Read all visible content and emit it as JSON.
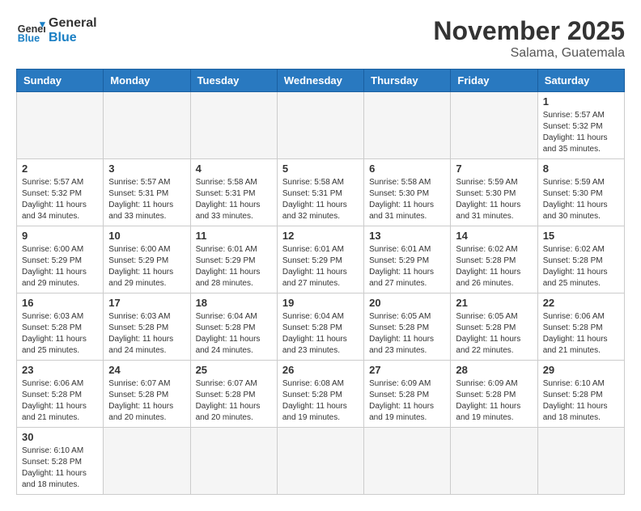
{
  "header": {
    "logo_general": "General",
    "logo_blue": "Blue",
    "month_title": "November 2025",
    "location": "Salama, Guatemala"
  },
  "weekdays": [
    "Sunday",
    "Monday",
    "Tuesday",
    "Wednesday",
    "Thursday",
    "Friday",
    "Saturday"
  ],
  "days": [
    {
      "date": "1",
      "empty": false,
      "colspan": false,
      "startCol": 6,
      "sunrise": "5:57 AM",
      "sunset": "5:32 PM",
      "daylight": "11 hours and 35 minutes."
    },
    {
      "date": "2",
      "sunrise": "5:57 AM",
      "sunset": "5:32 PM",
      "daylight": "11 hours and 34 minutes."
    },
    {
      "date": "3",
      "sunrise": "5:57 AM",
      "sunset": "5:31 PM",
      "daylight": "11 hours and 33 minutes."
    },
    {
      "date": "4",
      "sunrise": "5:58 AM",
      "sunset": "5:31 PM",
      "daylight": "11 hours and 33 minutes."
    },
    {
      "date": "5",
      "sunrise": "5:58 AM",
      "sunset": "5:31 PM",
      "daylight": "11 hours and 32 minutes."
    },
    {
      "date": "6",
      "sunrise": "5:58 AM",
      "sunset": "5:30 PM",
      "daylight": "11 hours and 31 minutes."
    },
    {
      "date": "7",
      "sunrise": "5:59 AM",
      "sunset": "5:30 PM",
      "daylight": "11 hours and 31 minutes."
    },
    {
      "date": "8",
      "sunrise": "5:59 AM",
      "sunset": "5:30 PM",
      "daylight": "11 hours and 30 minutes."
    },
    {
      "date": "9",
      "sunrise": "6:00 AM",
      "sunset": "5:29 PM",
      "daylight": "11 hours and 29 minutes."
    },
    {
      "date": "10",
      "sunrise": "6:00 AM",
      "sunset": "5:29 PM",
      "daylight": "11 hours and 29 minutes."
    },
    {
      "date": "11",
      "sunrise": "6:01 AM",
      "sunset": "5:29 PM",
      "daylight": "11 hours and 28 minutes."
    },
    {
      "date": "12",
      "sunrise": "6:01 AM",
      "sunset": "5:29 PM",
      "daylight": "11 hours and 27 minutes."
    },
    {
      "date": "13",
      "sunrise": "6:01 AM",
      "sunset": "5:29 PM",
      "daylight": "11 hours and 27 minutes."
    },
    {
      "date": "14",
      "sunrise": "6:02 AM",
      "sunset": "5:28 PM",
      "daylight": "11 hours and 26 minutes."
    },
    {
      "date": "15",
      "sunrise": "6:02 AM",
      "sunset": "5:28 PM",
      "daylight": "11 hours and 25 minutes."
    },
    {
      "date": "16",
      "sunrise": "6:03 AM",
      "sunset": "5:28 PM",
      "daylight": "11 hours and 25 minutes."
    },
    {
      "date": "17",
      "sunrise": "6:03 AM",
      "sunset": "5:28 PM",
      "daylight": "11 hours and 24 minutes."
    },
    {
      "date": "18",
      "sunrise": "6:04 AM",
      "sunset": "5:28 PM",
      "daylight": "11 hours and 24 minutes."
    },
    {
      "date": "19",
      "sunrise": "6:04 AM",
      "sunset": "5:28 PM",
      "daylight": "11 hours and 23 minutes."
    },
    {
      "date": "20",
      "sunrise": "6:05 AM",
      "sunset": "5:28 PM",
      "daylight": "11 hours and 23 minutes."
    },
    {
      "date": "21",
      "sunrise": "6:05 AM",
      "sunset": "5:28 PM",
      "daylight": "11 hours and 22 minutes."
    },
    {
      "date": "22",
      "sunrise": "6:06 AM",
      "sunset": "5:28 PM",
      "daylight": "11 hours and 21 minutes."
    },
    {
      "date": "23",
      "sunrise": "6:06 AM",
      "sunset": "5:28 PM",
      "daylight": "11 hours and 21 minutes."
    },
    {
      "date": "24",
      "sunrise": "6:07 AM",
      "sunset": "5:28 PM",
      "daylight": "11 hours and 20 minutes."
    },
    {
      "date": "25",
      "sunrise": "6:07 AM",
      "sunset": "5:28 PM",
      "daylight": "11 hours and 20 minutes."
    },
    {
      "date": "26",
      "sunrise": "6:08 AM",
      "sunset": "5:28 PM",
      "daylight": "11 hours and 19 minutes."
    },
    {
      "date": "27",
      "sunrise": "6:09 AM",
      "sunset": "5:28 PM",
      "daylight": "11 hours and 19 minutes."
    },
    {
      "date": "28",
      "sunrise": "6:09 AM",
      "sunset": "5:28 PM",
      "daylight": "11 hours and 19 minutes."
    },
    {
      "date": "29",
      "sunrise": "6:10 AM",
      "sunset": "5:28 PM",
      "daylight": "11 hours and 18 minutes."
    },
    {
      "date": "30",
      "sunrise": "6:10 AM",
      "sunset": "5:28 PM",
      "daylight": "11 hours and 18 minutes."
    }
  ],
  "labels": {
    "sunrise": "Sunrise:",
    "sunset": "Sunset:",
    "daylight": "Daylight:"
  }
}
